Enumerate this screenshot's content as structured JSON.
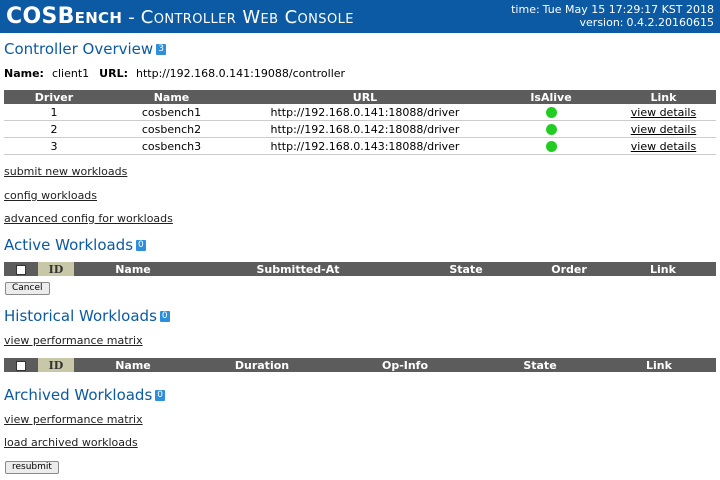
{
  "banner": {
    "title": "COSBench",
    "separator": "-",
    "subtitle": "Controller Web Console",
    "time_label": "time:",
    "time_value": "Tue May 15 17:29:17 KST 2018",
    "version_label": "version:",
    "version_value": "0.4.2.20160615"
  },
  "controller": {
    "heading": "Controller Overview",
    "count": "3",
    "name_label": "Name:",
    "name_value": "client1",
    "url_label": "URL:",
    "url_value": "http://192.168.0.141:19088/controller",
    "columns": [
      "Driver",
      "Name",
      "URL",
      "IsAlive",
      "Link"
    ],
    "drivers": [
      {
        "id": "1",
        "name": "cosbench1",
        "url": "http://192.168.0.141:18088/driver",
        "alive": true,
        "link": "view details"
      },
      {
        "id": "2",
        "name": "cosbench2",
        "url": "http://192.168.0.142:18088/driver",
        "alive": true,
        "link": "view details"
      },
      {
        "id": "3",
        "name": "cosbench3",
        "url": "http://192.168.0.143:18088/driver",
        "alive": true,
        "link": "view details"
      }
    ]
  },
  "links": {
    "submit": "submit new workloads",
    "config": "config workloads",
    "advanced": "advanced config for workloads"
  },
  "active": {
    "heading": "Active Workloads",
    "count": "0",
    "columns": [
      "ID",
      "Name",
      "Submitted-At",
      "State",
      "Order",
      "Link"
    ],
    "cancel_label": "Cancel"
  },
  "historical": {
    "heading": "Historical Workloads",
    "count": "0",
    "matrix_link": "view performance matrix",
    "columns": [
      "ID",
      "Name",
      "Duration",
      "Op-Info",
      "State",
      "Link"
    ]
  },
  "archived": {
    "heading": "Archived Workloads",
    "count": "0",
    "matrix_link": "view performance matrix",
    "load_link": "load archived workloads",
    "resubmit_label": "resubmit"
  },
  "colors": {
    "banner": "#0b5aa3",
    "heading": "#0b5aa3",
    "badge": "#2e8fdc",
    "alive": "#22cc22",
    "table_header": "#5c5c5c"
  }
}
